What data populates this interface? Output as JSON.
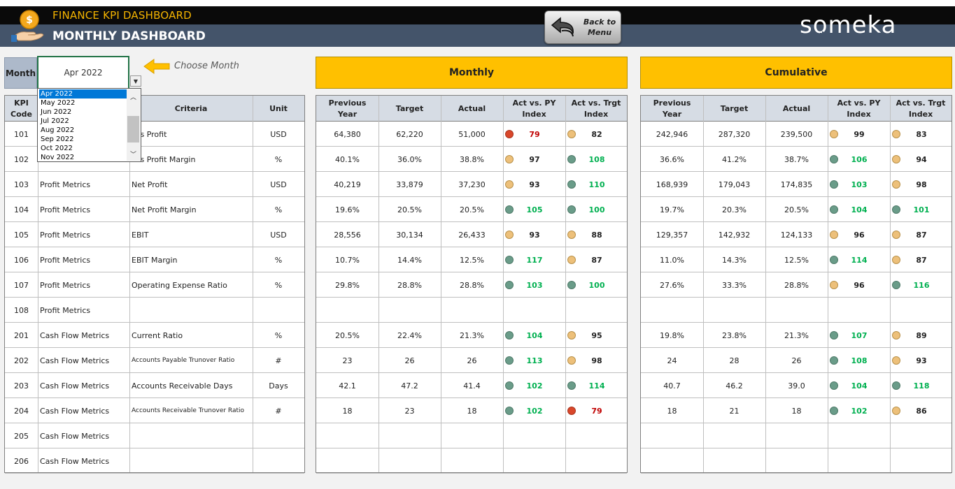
{
  "header": {
    "app_title": "FINANCE KPI DASHBOARD",
    "page_title": "MONTHLY DASHBOARD",
    "back_button": "Back to Menu",
    "brand": "someka",
    "colors": {
      "header_bg": "#44546a",
      "accent": "#ffc000",
      "title_gold": "#f4b400"
    }
  },
  "month_picker": {
    "label": "Month",
    "value": "Apr 2022",
    "hint": "Choose Month",
    "options": [
      "Apr 2022",
      "May 2022",
      "Jun 2022",
      "Jul 2022",
      "Aug 2022",
      "Sep 2022",
      "Oct 2022",
      "Nov 2022"
    ],
    "selected_index": 0
  },
  "sections": {
    "monthly": "Monthly",
    "cumulative": "Cumulative"
  },
  "left_headers": {
    "code": "KPI Code",
    "group": "",
    "criteria": "Criteria",
    "unit": "Unit"
  },
  "value_headers": {
    "py": "Previous Year",
    "target": "Target",
    "actual": "Actual",
    "act_py": "Act vs. PY Index",
    "act_trgt": "Act vs. Trgt Index"
  },
  "rows": [
    {
      "code": "101",
      "group": "",
      "criteria": "oss Profit",
      "unit": "USD",
      "small": false,
      "m": {
        "py": "64,380",
        "tg": "62,220",
        "ac": "51,000",
        "i1": "79",
        "s1": "red",
        "i2": "82",
        "s2": "amber"
      },
      "c": {
        "py": "242,946",
        "tg": "287,320",
        "ac": "239,500",
        "i1": "99",
        "s1": "amber",
        "i2": "83",
        "s2": "amber"
      }
    },
    {
      "code": "102",
      "group": "",
      "criteria": "oss Profit Margin",
      "unit": "%",
      "small": false,
      "m": {
        "py": "40.1%",
        "tg": "36.0%",
        "ac": "38.8%",
        "i1": "97",
        "s1": "amber",
        "i2": "108",
        "s2": "green"
      },
      "c": {
        "py": "36.6%",
        "tg": "41.2%",
        "ac": "38.7%",
        "i1": "106",
        "s1": "green",
        "i2": "94",
        "s2": "amber"
      }
    },
    {
      "code": "103",
      "group": "Profit Metrics",
      "criteria": "Net Profit",
      "unit": "USD",
      "small": false,
      "m": {
        "py": "40,219",
        "tg": "33,879",
        "ac": "37,230",
        "i1": "93",
        "s1": "amber",
        "i2": "110",
        "s2": "green"
      },
      "c": {
        "py": "168,939",
        "tg": "179,043",
        "ac": "174,835",
        "i1": "103",
        "s1": "green",
        "i2": "98",
        "s2": "amber"
      }
    },
    {
      "code": "104",
      "group": "Profit Metrics",
      "criteria": "Net Profit Margin",
      "unit": "%",
      "small": false,
      "m": {
        "py": "19.6%",
        "tg": "20.5%",
        "ac": "20.5%",
        "i1": "105",
        "s1": "green",
        "i2": "100",
        "s2": "green"
      },
      "c": {
        "py": "19.7%",
        "tg": "20.3%",
        "ac": "20.5%",
        "i1": "104",
        "s1": "green",
        "i2": "101",
        "s2": "green"
      }
    },
    {
      "code": "105",
      "group": "Profit Metrics",
      "criteria": "EBIT",
      "unit": "USD",
      "small": false,
      "m": {
        "py": "28,556",
        "tg": "30,134",
        "ac": "26,433",
        "i1": "93",
        "s1": "amber",
        "i2": "88",
        "s2": "amber"
      },
      "c": {
        "py": "129,357",
        "tg": "142,932",
        "ac": "124,133",
        "i1": "96",
        "s1": "amber",
        "i2": "87",
        "s2": "amber"
      }
    },
    {
      "code": "106",
      "group": "Profit Metrics",
      "criteria": "EBIT Margin",
      "unit": "%",
      "small": false,
      "m": {
        "py": "10.7%",
        "tg": "14.4%",
        "ac": "12.5%",
        "i1": "117",
        "s1": "green",
        "i2": "87",
        "s2": "amber"
      },
      "c": {
        "py": "11.0%",
        "tg": "14.3%",
        "ac": "12.5%",
        "i1": "114",
        "s1": "green",
        "i2": "87",
        "s2": "amber"
      }
    },
    {
      "code": "107",
      "group": "Profit Metrics",
      "criteria": "Operating Expense Ratio",
      "unit": "%",
      "small": false,
      "m": {
        "py": "29.8%",
        "tg": "28.8%",
        "ac": "28.8%",
        "i1": "103",
        "s1": "green",
        "i2": "100",
        "s2": "green"
      },
      "c": {
        "py": "27.6%",
        "tg": "33.3%",
        "ac": "28.8%",
        "i1": "96",
        "s1": "amber",
        "i2": "116",
        "s2": "green"
      }
    },
    {
      "code": "108",
      "group": "Profit Metrics",
      "criteria": "",
      "unit": "",
      "small": false,
      "m": {
        "py": "",
        "tg": "",
        "ac": "",
        "i1": "",
        "s1": "",
        "i2": "",
        "s2": ""
      },
      "c": {
        "py": "",
        "tg": "",
        "ac": "",
        "i1": "",
        "s1": "",
        "i2": "",
        "s2": ""
      }
    },
    {
      "code": "201",
      "group": "Cash Flow Metrics",
      "criteria": "Current Ratio",
      "unit": "%",
      "small": false,
      "m": {
        "py": "20.5%",
        "tg": "22.4%",
        "ac": "21.3%",
        "i1": "104",
        "s1": "green",
        "i2": "95",
        "s2": "amber"
      },
      "c": {
        "py": "19.8%",
        "tg": "23.8%",
        "ac": "21.3%",
        "i1": "107",
        "s1": "green",
        "i2": "89",
        "s2": "amber"
      }
    },
    {
      "code": "202",
      "group": "Cash Flow Metrics",
      "criteria": "Accounts Payable Trunover Ratio",
      "unit": "#",
      "small": true,
      "m": {
        "py": "23",
        "tg": "26",
        "ac": "26",
        "i1": "113",
        "s1": "green",
        "i2": "98",
        "s2": "amber"
      },
      "c": {
        "py": "24",
        "tg": "28",
        "ac": "26",
        "i1": "108",
        "s1": "green",
        "i2": "93",
        "s2": "amber"
      }
    },
    {
      "code": "203",
      "group": "Cash Flow Metrics",
      "criteria": "Accounts Receivable Days",
      "unit": "Days",
      "small": false,
      "m": {
        "py": "42.1",
        "tg": "47.2",
        "ac": "41.4",
        "i1": "102",
        "s1": "green",
        "i2": "114",
        "s2": "green"
      },
      "c": {
        "py": "40.7",
        "tg": "46.2",
        "ac": "39.0",
        "i1": "104",
        "s1": "green",
        "i2": "118",
        "s2": "green"
      }
    },
    {
      "code": "204",
      "group": "Cash Flow Metrics",
      "criteria": "Accounts Receivable Trunover Ratio",
      "unit": "#",
      "small": true,
      "m": {
        "py": "18",
        "tg": "23",
        "ac": "18",
        "i1": "102",
        "s1": "green",
        "i2": "79",
        "s2": "red"
      },
      "c": {
        "py": "18",
        "tg": "21",
        "ac": "18",
        "i1": "102",
        "s1": "green",
        "i2": "86",
        "s2": "amber"
      }
    },
    {
      "code": "205",
      "group": "Cash Flow Metrics",
      "criteria": "",
      "unit": "",
      "small": false,
      "m": {
        "py": "",
        "tg": "",
        "ac": "",
        "i1": "",
        "s1": "",
        "i2": "",
        "s2": ""
      },
      "c": {
        "py": "",
        "tg": "",
        "ac": "",
        "i1": "",
        "s1": "",
        "i2": "",
        "s2": ""
      }
    },
    {
      "code": "206",
      "group": "Cash Flow Metrics",
      "criteria": "",
      "unit": "",
      "small": false,
      "m": {
        "py": "",
        "tg": "",
        "ac": "",
        "i1": "",
        "s1": "",
        "i2": "",
        "s2": ""
      },
      "c": {
        "py": "",
        "tg": "",
        "ac": "",
        "i1": "",
        "s1": "",
        "i2": "",
        "s2": ""
      }
    }
  ]
}
